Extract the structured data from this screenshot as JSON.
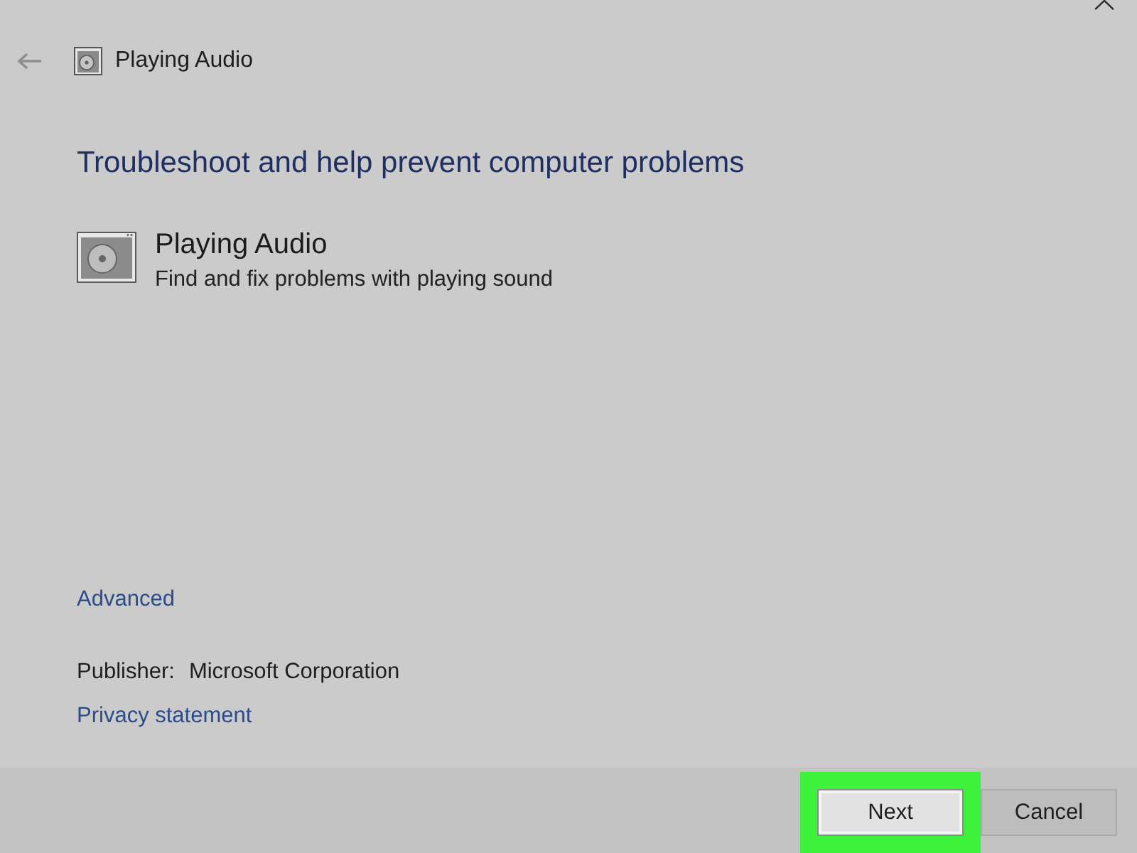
{
  "window": {
    "title": "Playing Audio"
  },
  "back_button": {
    "disabled": true
  },
  "heading": "Troubleshoot and help prevent computer problems",
  "troubleshooter": {
    "name": "Playing Audio",
    "description": "Find and fix problems with playing sound"
  },
  "advanced_link": "Advanced",
  "publisher": {
    "label": "Publisher:",
    "value": "Microsoft Corporation"
  },
  "privacy_link": "Privacy statement",
  "buttons": [
    {
      "label": "Next",
      "default": true,
      "highlighted": true
    },
    {
      "label": "Cancel",
      "default": false,
      "highlighted": false
    }
  ]
}
